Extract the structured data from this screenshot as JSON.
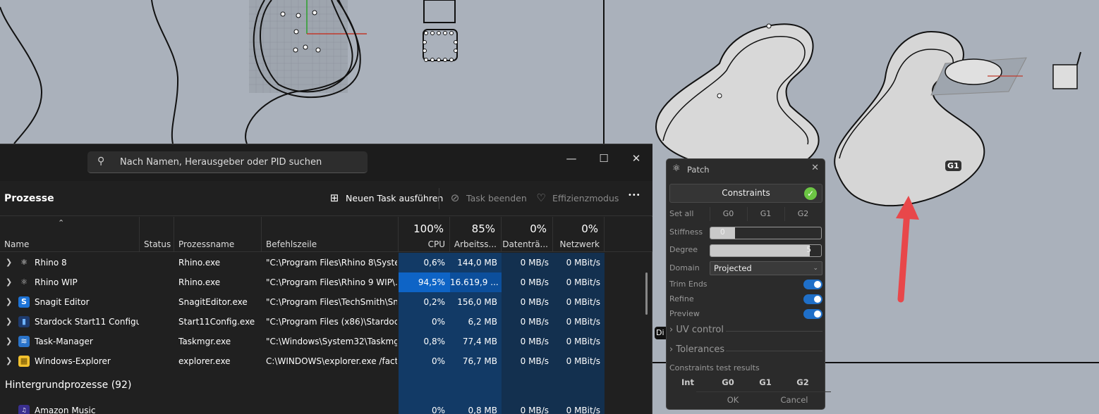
{
  "viewport": {
    "g1_label": "G1",
    "di_label": "Di"
  },
  "taskmanager": {
    "search_placeholder": "Nach Namen, Herausgeber oder PID suchen",
    "page_title": "Prozesse",
    "toolbar": {
      "new_task": "Neuen Task ausführen",
      "end_task": "Task beenden",
      "efficiency": "Effizienzmodus",
      "more": "•••"
    },
    "columns": {
      "name": "Name",
      "status": "Status",
      "process": "Prozessname",
      "command": "Befehlszeile",
      "cpu_pct": "100%",
      "cpu": "CPU",
      "mem_pct": "85%",
      "mem": "Arbeitss...",
      "disk_pct": "0%",
      "disk": "Datenträ...",
      "net_pct": "0%",
      "net": "Netzwerk"
    },
    "rows": [
      {
        "name": "Rhino 8",
        "process": "Rhino.exe",
        "command": "\"C:\\Program Files\\Rhino 8\\Syste...",
        "cpu": "0,6%",
        "mem": "144,0 MB",
        "disk": "0 MB/s",
        "net": "0 MBit/s"
      },
      {
        "name": "Rhino WIP",
        "process": "Rhino.exe",
        "command": "\"C:\\Program Files\\Rhino 9 WIP\\...",
        "cpu": "94,5%",
        "mem": "16.619,9 ...",
        "disk": "0 MB/s",
        "net": "0 MBit/s"
      },
      {
        "name": "Snagit Editor",
        "process": "SnagitEditor.exe",
        "command": "\"C:\\Program Files\\TechSmith\\Sn...",
        "cpu": "0,2%",
        "mem": "156,0 MB",
        "disk": "0 MB/s",
        "net": "0 MBit/s"
      },
      {
        "name": "Stardock Start11 Configu...",
        "process": "Start11Config.exe",
        "command": "\"C:\\Program Files (x86)\\Stardock...",
        "cpu": "0%",
        "mem": "6,2 MB",
        "disk": "0 MB/s",
        "net": "0 MBit/s"
      },
      {
        "name": "Task-Manager",
        "process": "Taskmgr.exe",
        "command": "\"C:\\Windows\\System32\\Taskmg...",
        "cpu": "0,8%",
        "mem": "77,4 MB",
        "disk": "0 MB/s",
        "net": "0 MBit/s"
      },
      {
        "name": "Windows-Explorer",
        "process": "explorer.exe",
        "command": "C:\\WINDOWS\\explorer.exe /fact...",
        "cpu": "0%",
        "mem": "76,7 MB",
        "disk": "0 MB/s",
        "net": "0 MBit/s"
      }
    ],
    "group_header": "Hintergrundprozesse (92)",
    "bg_rows": [
      {
        "name": "Amazon Music",
        "cpu": "0%",
        "mem": "0,8 MB",
        "disk": "0 MB/s",
        "net": "0 MBit/s"
      }
    ]
  },
  "patch": {
    "title": "Patch",
    "constraints": "Constraints",
    "set_all": "Set all",
    "g0": "G0",
    "g1": "G1",
    "g2": "G2",
    "stiffness_label": "Stiffness",
    "stiffness_value": "0",
    "degree_label": "Degree",
    "degree_value": "5",
    "degree_fraction": 0.9,
    "stiffness_fraction": 0.22,
    "domain_label": "Domain",
    "domain_value": "Projected",
    "trim_ends": "Trim Ends",
    "refine": "Refine",
    "preview": "Preview",
    "uv_control": "UV control",
    "tolerances": "Tolerances",
    "results_title": "Constraints test results",
    "results": [
      "Int",
      "G0",
      "G1",
      "G2"
    ],
    "ok": "OK",
    "cancel": "Cancel"
  },
  "colors": {
    "accent": "#1f6fc8",
    "cpu_high": "#0e64c6",
    "check": "#6cc644",
    "arrow": "#e8474a"
  }
}
